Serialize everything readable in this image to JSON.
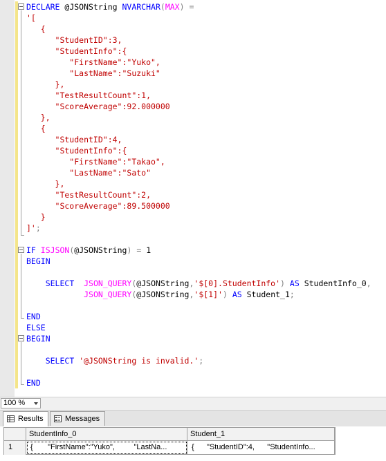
{
  "editor": {
    "lines": [
      [
        {
          "t": "DECLARE",
          "c": "kw"
        },
        {
          "t": " @JSONString ",
          "c": ""
        },
        {
          "t": "NVARCHAR",
          "c": "kw"
        },
        {
          "t": "(",
          "c": "gray"
        },
        {
          "t": "MAX",
          "c": "fn"
        },
        {
          "t": ")",
          "c": "gray"
        },
        {
          "t": " ",
          "c": ""
        },
        {
          "t": "=",
          "c": "gray"
        }
      ],
      [
        {
          "t": "'[",
          "c": "str"
        }
      ],
      [
        {
          "t": "   {",
          "c": "str"
        }
      ],
      [
        {
          "t": "      \"StudentID\":3,",
          "c": "str"
        }
      ],
      [
        {
          "t": "      \"StudentInfo\":{",
          "c": "str"
        }
      ],
      [
        {
          "t": "         \"FirstName\":\"Yuko\",",
          "c": "str"
        }
      ],
      [
        {
          "t": "         \"LastName\":\"Suzuki\"",
          "c": "str"
        }
      ],
      [
        {
          "t": "      },",
          "c": "str"
        }
      ],
      [
        {
          "t": "      \"TestResultCount\":1,",
          "c": "str"
        }
      ],
      [
        {
          "t": "      \"ScoreAverage\":92.000000",
          "c": "str"
        }
      ],
      [
        {
          "t": "   },",
          "c": "str"
        }
      ],
      [
        {
          "t": "   {",
          "c": "str"
        }
      ],
      [
        {
          "t": "      \"StudentID\":4,",
          "c": "str"
        }
      ],
      [
        {
          "t": "      \"StudentInfo\":{",
          "c": "str"
        }
      ],
      [
        {
          "t": "         \"FirstName\":\"Takao\",",
          "c": "str"
        }
      ],
      [
        {
          "t": "         \"LastName\":\"Sato\"",
          "c": "str"
        }
      ],
      [
        {
          "t": "      },",
          "c": "str"
        }
      ],
      [
        {
          "t": "      \"TestResultCount\":2,",
          "c": "str"
        }
      ],
      [
        {
          "t": "      \"ScoreAverage\":89.500000",
          "c": "str"
        }
      ],
      [
        {
          "t": "   }",
          "c": "str"
        }
      ],
      [
        {
          "t": "]'",
          "c": "str"
        },
        {
          "t": ";",
          "c": "gray"
        }
      ],
      [],
      [
        {
          "t": "IF",
          "c": "kw"
        },
        {
          "t": " ",
          "c": ""
        },
        {
          "t": "ISJSON",
          "c": "fn"
        },
        {
          "t": "(",
          "c": "gray"
        },
        {
          "t": "@JSONString",
          "c": ""
        },
        {
          "t": ")",
          "c": "gray"
        },
        {
          "t": " ",
          "c": ""
        },
        {
          "t": "=",
          "c": "gray"
        },
        {
          "t": " 1",
          "c": ""
        }
      ],
      [
        {
          "t": "BEGIN",
          "c": "kw"
        }
      ],
      [],
      [
        {
          "t": "    ",
          "c": ""
        },
        {
          "t": "SELECT",
          "c": "kw"
        },
        {
          "t": "  ",
          "c": ""
        },
        {
          "t": "JSON_QUERY",
          "c": "fn"
        },
        {
          "t": "(",
          "c": "gray"
        },
        {
          "t": "@JSONString",
          "c": ""
        },
        {
          "t": ",",
          "c": "gray"
        },
        {
          "t": "'$[0].StudentInfo'",
          "c": "str"
        },
        {
          "t": ")",
          "c": "gray"
        },
        {
          "t": " ",
          "c": ""
        },
        {
          "t": "AS",
          "c": "kw"
        },
        {
          "t": " StudentInfo_0",
          "c": ""
        },
        {
          "t": ",",
          "c": "gray"
        }
      ],
      [
        {
          "t": "            ",
          "c": ""
        },
        {
          "t": "JSON_QUERY",
          "c": "fn"
        },
        {
          "t": "(",
          "c": "gray"
        },
        {
          "t": "@JSONString",
          "c": ""
        },
        {
          "t": ",",
          "c": "gray"
        },
        {
          "t": "'$[1]'",
          "c": "str"
        },
        {
          "t": ")",
          "c": "gray"
        },
        {
          "t": " ",
          "c": ""
        },
        {
          "t": "AS",
          "c": "kw"
        },
        {
          "t": " Student_1",
          "c": ""
        },
        {
          "t": ";",
          "c": "gray"
        }
      ],
      [],
      [
        {
          "t": "END",
          "c": "kw"
        }
      ],
      [
        {
          "t": "ELSE",
          "c": "kw"
        }
      ],
      [
        {
          "t": "BEGIN",
          "c": "kw"
        }
      ],
      [],
      [
        {
          "t": "    ",
          "c": ""
        },
        {
          "t": "SELECT",
          "c": "kw"
        },
        {
          "t": " ",
          "c": ""
        },
        {
          "t": "'@JSONString is invalid.'",
          "c": "str"
        },
        {
          "t": ";",
          "c": "gray"
        }
      ],
      [],
      [
        {
          "t": "END",
          "c": "kw"
        }
      ]
    ]
  },
  "statusbar": {
    "zoom": "100 %"
  },
  "tabs": [
    {
      "label": "Results",
      "icon": "grid-icon",
      "active": true
    },
    {
      "label": "Messages",
      "icon": "messages-icon",
      "active": false
    }
  ],
  "results": {
    "columns": [
      "StudentInfo_0",
      "Student_1"
    ],
    "rows": [
      {
        "num": "1",
        "cells": [
          "{       \"FirstName\":\"Yuko\",         \"LastNa...",
          "{      \"StudentID\":4,      \"StudentInfo..."
        ]
      }
    ]
  }
}
